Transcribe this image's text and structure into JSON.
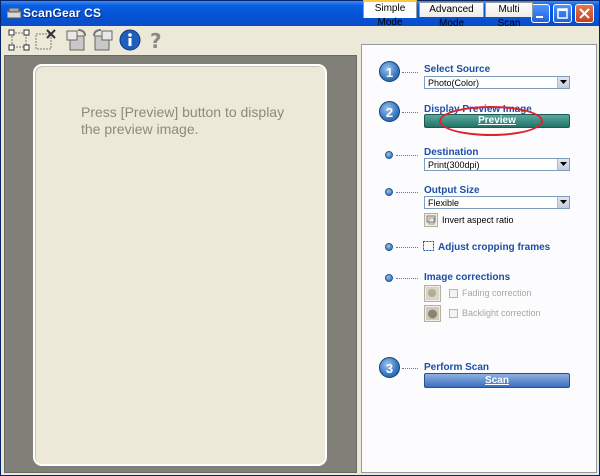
{
  "window": {
    "title": "ScanGear CS"
  },
  "titlebar_buttons": {
    "minimize": "minimize",
    "maximize": "maximize",
    "close": "close"
  },
  "toolbar": {
    "tools": [
      "auto-crop-icon",
      "remove-crop-icon",
      "rotate-left-icon",
      "rotate-right-icon",
      "info-icon",
      "help-icon"
    ]
  },
  "preview": {
    "message_line1": "Press [Preview] button to display",
    "message_line2": "the preview image."
  },
  "tabs": [
    {
      "label": "Simple Mode",
      "active": true
    },
    {
      "label": "Advanced Mode",
      "active": false
    },
    {
      "label": "Multi Scan",
      "active": false
    }
  ],
  "steps": {
    "step1": {
      "number": "1",
      "label": "Select Source",
      "value": "Photo(Color)"
    },
    "step2": {
      "number": "2",
      "label": "Display Preview Image",
      "button": "Preview"
    },
    "destination": {
      "label": "Destination",
      "value": "Print(300dpi)"
    },
    "output_size": {
      "label": "Output Size",
      "value": "Flexible",
      "invert_label": "Invert aspect ratio"
    },
    "crop": {
      "label": "Adjust cropping frames"
    },
    "corrections": {
      "label": "Image corrections",
      "fading": "Fading correction",
      "backlight": "Backlight correction"
    },
    "step3": {
      "number": "3",
      "label": "Perform Scan",
      "button": "Scan"
    }
  },
  "colors": {
    "accent": "#1c4fa5",
    "preview_button": "#237367",
    "highlight": "#e0202c"
  }
}
